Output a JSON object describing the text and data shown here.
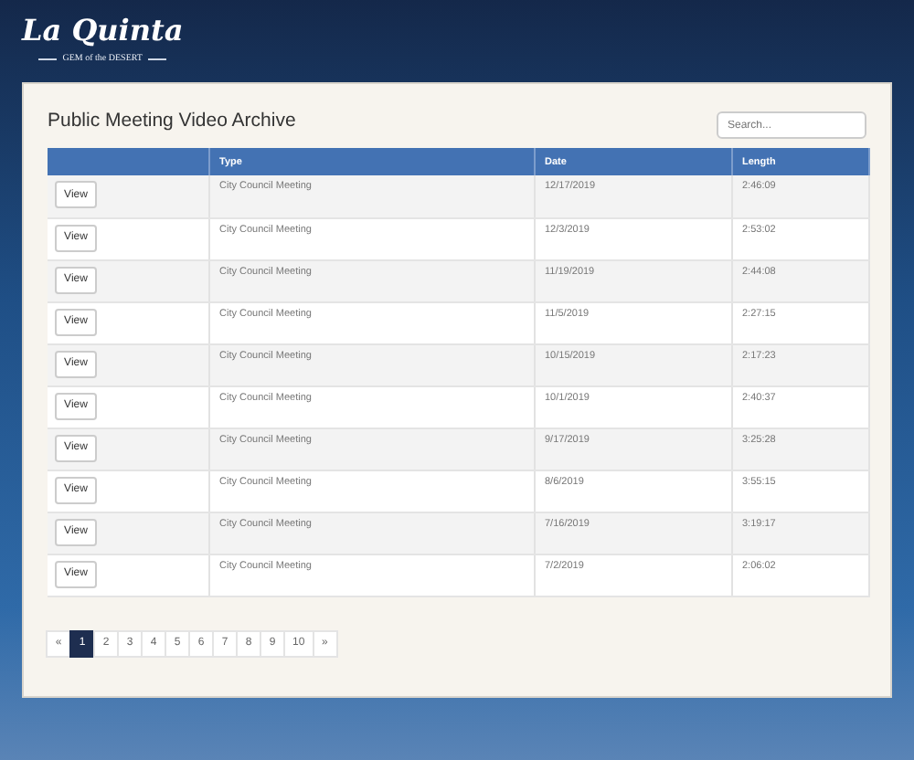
{
  "logo": {
    "name": "La Quinta",
    "tagline": "GEM of the DESERT"
  },
  "title": "Public Meeting Video Archive",
  "search": {
    "placeholder": "Search..."
  },
  "table": {
    "columns": [
      "",
      "Type",
      "Date",
      "Length"
    ],
    "rows": [
      {
        "action": "View",
        "type": "City Council Meeting",
        "date": "12/17/2019",
        "length": "2:46:09"
      },
      {
        "action": "View",
        "type": "City Council Meeting",
        "date": "12/3/2019",
        "length": "2:53:02"
      },
      {
        "action": "View",
        "type": "City Council Meeting",
        "date": "11/19/2019",
        "length": "2:44:08"
      },
      {
        "action": "View",
        "type": "City Council Meeting",
        "date": "11/5/2019",
        "length": "2:27:15"
      },
      {
        "action": "View",
        "type": "City Council Meeting",
        "date": "10/15/2019",
        "length": "2:17:23"
      },
      {
        "action": "View",
        "type": "City Council Meeting",
        "date": "10/1/2019",
        "length": "2:40:37"
      },
      {
        "action": "View",
        "type": "City Council Meeting",
        "date": "9/17/2019",
        "length": "3:25:28"
      },
      {
        "action": "View",
        "type": "City Council Meeting",
        "date": "8/6/2019",
        "length": "3:55:15"
      },
      {
        "action": "View",
        "type": "City Council Meeting",
        "date": "7/16/2019",
        "length": "3:19:17"
      },
      {
        "action": "View",
        "type": "City Council Meeting",
        "date": "7/2/2019",
        "length": "2:06:02"
      }
    ]
  },
  "pagination": [
    {
      "label": "«",
      "selected": false
    },
    {
      "label": "1",
      "selected": true
    },
    {
      "label": "2",
      "selected": false
    },
    {
      "label": "3",
      "selected": false
    },
    {
      "label": "4",
      "selected": false
    },
    {
      "label": "5",
      "selected": false
    },
    {
      "label": "6",
      "selected": false
    },
    {
      "label": "7",
      "selected": false
    },
    {
      "label": "8",
      "selected": false
    },
    {
      "label": "9",
      "selected": false
    },
    {
      "label": "10",
      "selected": false
    },
    {
      "label": "»",
      "selected": false
    }
  ]
}
